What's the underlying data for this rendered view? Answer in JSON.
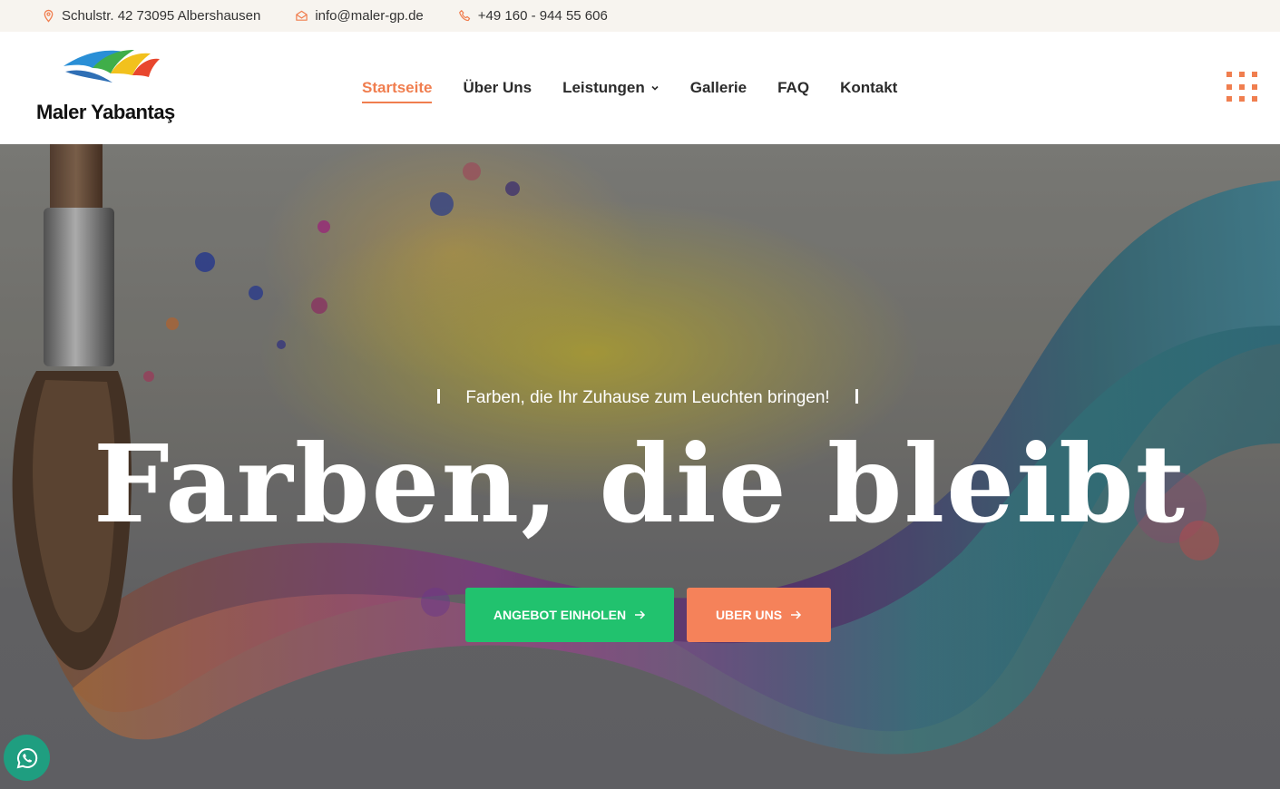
{
  "topbar": {
    "address": "Schulstr. 42 73095 Albershausen",
    "email": "info@maler-gp.de",
    "phone": "+49 160 - 944 55 606"
  },
  "logo": {
    "text": "Maler Yabantaş"
  },
  "nav": {
    "items": [
      {
        "label": "Startseite",
        "active": true
      },
      {
        "label": "Über Uns"
      },
      {
        "label": "Leistungen",
        "has_dropdown": true
      },
      {
        "label": "Gallerie"
      },
      {
        "label": "FAQ"
      },
      {
        "label": "Kontakt"
      }
    ]
  },
  "hero": {
    "subtitle": "Farben, die Ihr Zuhause zum Leuchten bringen!",
    "headline": "Farben, die bleibt",
    "cta_primary": "ANGEBOT EINHOLEN",
    "cta_secondary": "UBER UNS"
  },
  "icons": [
    "location-pin-icon",
    "envelope-icon",
    "phone-icon",
    "chevron-down-icon",
    "grid-menu-icon",
    "arrow-right-icon",
    "whatsapp-icon"
  ],
  "colors": {
    "accent": "#f07e4f",
    "green": "#21c26e",
    "orange": "#f5825a",
    "whatsapp": "#1f9e80"
  }
}
